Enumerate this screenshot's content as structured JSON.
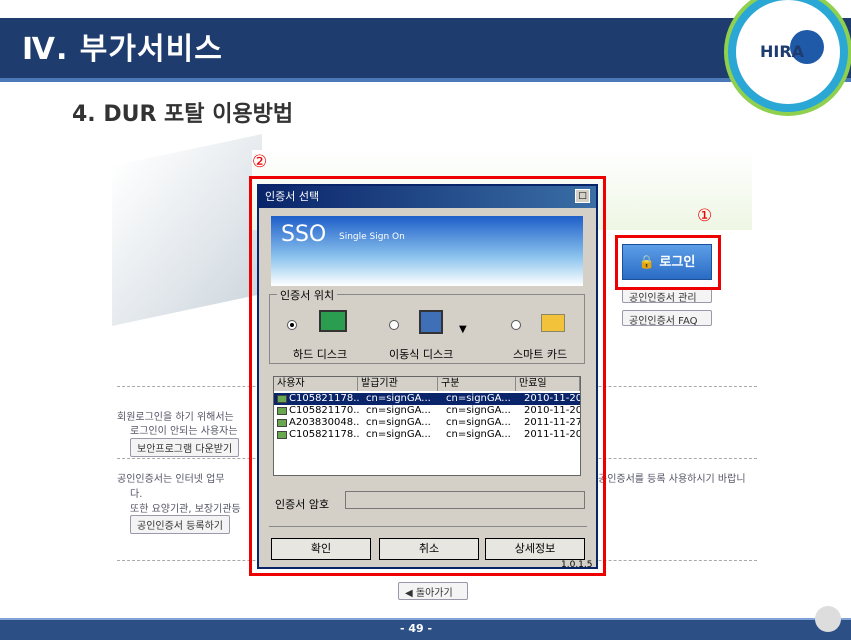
{
  "header": {
    "title": "Ⅳ. 부가서비스",
    "logo_text": "HIRA"
  },
  "subtitle": "4. DUR 포탈 이용방법",
  "markers": {
    "one": "①",
    "two": "②"
  },
  "login_page": {
    "login_button": "로그인",
    "cert_manage": "공인인증서 관리",
    "cert_faq": "공인인증서 FAQ",
    "notice1_line1": "회원로그인을 하기 위해서는",
    "notice1_line2": "로그인이 안되는 사용자는",
    "security_download": "보안프로그램 다운받기",
    "notice2_line1": "공인인증서는 인터넷 업무",
    "notice2_right": "공인증서를 등록 사용하시기 바랍니",
    "notice2_line2": "다.",
    "notice2_line3": "또한 요양기관, 보장기관등",
    "cert_register": "공인인증서 등록하기",
    "back_button": "돌아가기"
  },
  "dialog": {
    "title": "인증서 선택",
    "banner_main": "SSO",
    "banner_sub": "Single Sign On",
    "location_group": "인증서 위치",
    "devices": [
      "하드 디스크",
      "이동식 디스크",
      "스마트 카드"
    ],
    "columns": [
      "사용자",
      "발급기관",
      "구분",
      "만료일"
    ],
    "rows": [
      {
        "user": "C105821178...",
        "issuer": "cn=signGA...",
        "type": "cn=signGA...",
        "expiry": "2010-11-20",
        "selected": true
      },
      {
        "user": "C105821170...",
        "issuer": "cn=signGA...",
        "type": "cn=signGA...",
        "expiry": "2010-11-20",
        "selected": false
      },
      {
        "user": "A203830048...",
        "issuer": "cn=signGA...",
        "type": "cn=signGA...",
        "expiry": "2011-11-27",
        "selected": false
      },
      {
        "user": "C105821178...",
        "issuer": "cn=signGA...",
        "type": "cn=signGA...",
        "expiry": "2011-11-20",
        "selected": false
      }
    ],
    "password_label": "인증서 암호",
    "buttons": {
      "ok": "확인",
      "cancel": "취소",
      "details": "상세정보"
    },
    "version": "1.0.1.5"
  },
  "footer": {
    "page": "- 49 -"
  }
}
